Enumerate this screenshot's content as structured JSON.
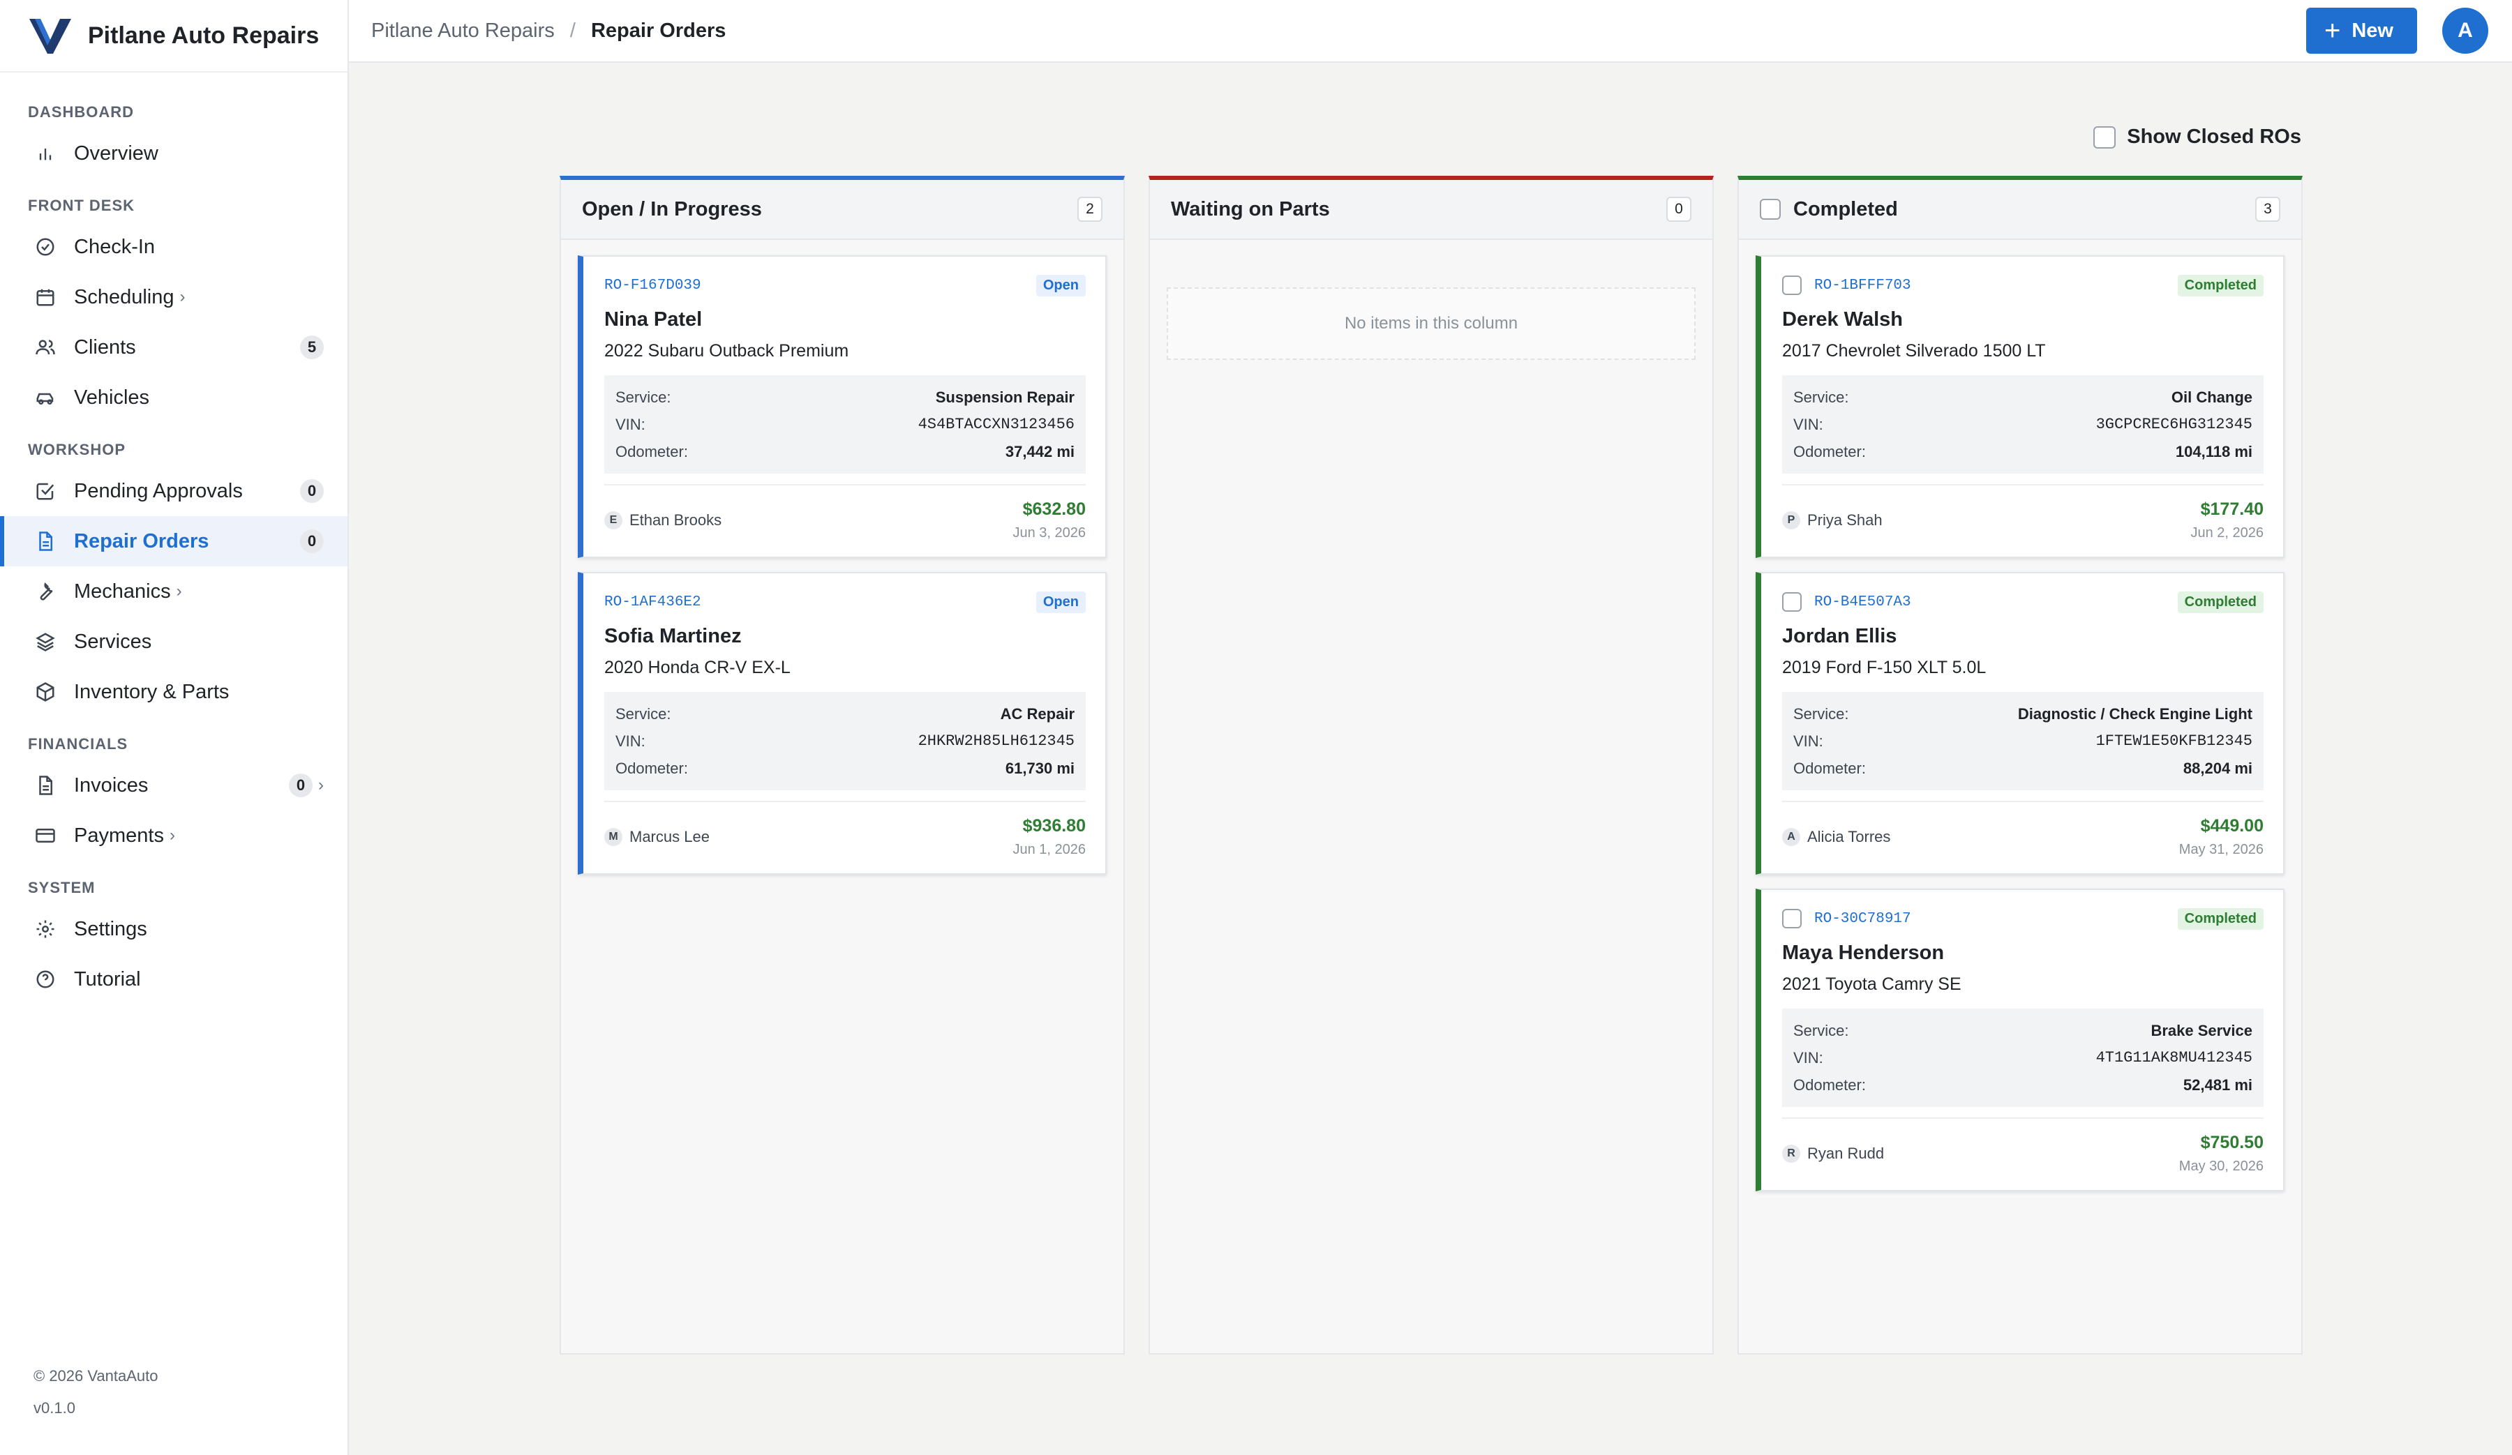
{
  "brand": {
    "name": "Pitlane Auto Repairs"
  },
  "sidebar": {
    "sections": [
      {
        "title": "DASHBOARD",
        "items": [
          {
            "label": "Overview",
            "icon": "bar-chart-icon"
          }
        ]
      },
      {
        "title": "FRONT DESK",
        "items": [
          {
            "label": "Check-In",
            "icon": "check-circle-icon"
          },
          {
            "label": "Scheduling",
            "icon": "calendar-icon",
            "chevron": true
          },
          {
            "label": "Clients",
            "icon": "users-icon",
            "badge": "5"
          },
          {
            "label": "Vehicles",
            "icon": "car-icon"
          }
        ]
      },
      {
        "title": "WORKSHOP",
        "items": [
          {
            "label": "Pending Approvals",
            "icon": "check-square-icon",
            "badge": "0"
          },
          {
            "label": "Repair Orders",
            "icon": "document-icon",
            "badge": "0",
            "active": true
          },
          {
            "label": "Mechanics",
            "icon": "wrench-icon",
            "chevron": true
          },
          {
            "label": "Services",
            "icon": "layers-icon"
          },
          {
            "label": "Inventory & Parts",
            "icon": "box-icon"
          }
        ]
      },
      {
        "title": "FINANCIALS",
        "items": [
          {
            "label": "Invoices",
            "icon": "document-icon",
            "badge": "0",
            "chevron": true
          },
          {
            "label": "Payments",
            "icon": "credit-card-icon",
            "chevron": true
          }
        ]
      },
      {
        "title": "SYSTEM",
        "items": [
          {
            "label": "Settings",
            "icon": "gear-icon"
          },
          {
            "label": "Tutorial",
            "icon": "help-circle-icon"
          }
        ]
      }
    ],
    "footer": {
      "copyright": "© 2026 VantaAuto",
      "version": "v0.1.0"
    }
  },
  "header": {
    "breadcrumb": {
      "root": "Pitlane Auto Repairs",
      "separator": "/",
      "current": "Repair Orders"
    },
    "new_button": "New",
    "avatar_initial": "A"
  },
  "board": {
    "show_closed_label": "Show Closed ROs",
    "columns": {
      "open": {
        "title": "Open / In Progress",
        "count": "2"
      },
      "waiting": {
        "title": "Waiting on Parts",
        "count": "0",
        "empty_text": "No items in this column"
      },
      "completed": {
        "title": "Completed",
        "count": "3"
      }
    },
    "detail_labels": {
      "service": "Service:",
      "vin": "VIN:",
      "odometer": "Odometer:"
    },
    "open_cards": [
      {
        "ro": "RO-F167D039",
        "status": "Open",
        "customer": "Nina Patel",
        "vehicle": "2022 Subaru Outback Premium",
        "service": "Suspension Repair",
        "vin": "4S4BTACCXN3123456",
        "odometer": "37,442 mi",
        "mechanic_initial": "E",
        "mechanic": "Ethan Brooks",
        "amount": "$632.80",
        "date": "Jun 3, 2026"
      },
      {
        "ro": "RO-1AF436E2",
        "status": "Open",
        "customer": "Sofia Martinez",
        "vehicle": "2020 Honda CR-V EX-L",
        "service": "AC Repair",
        "vin": "2HKRW2H85LH612345",
        "odometer": "61,730 mi",
        "mechanic_initial": "M",
        "mechanic": "Marcus Lee",
        "amount": "$936.80",
        "date": "Jun 1, 2026"
      }
    ],
    "completed_cards": [
      {
        "ro": "RO-1BFFF703",
        "status": "Completed",
        "customer": "Derek Walsh",
        "vehicle": "2017 Chevrolet Silverado 1500 LT",
        "service": "Oil Change",
        "vin": "3GCPCREC6HG312345",
        "odometer": "104,118 mi",
        "mechanic_initial": "P",
        "mechanic": "Priya Shah",
        "amount": "$177.40",
        "date": "Jun 2, 2026"
      },
      {
        "ro": "RO-B4E507A3",
        "status": "Completed",
        "customer": "Jordan Ellis",
        "vehicle": "2019 Ford F-150 XLT 5.0L",
        "service": "Diagnostic / Check Engine Light",
        "vin": "1FTEW1E50KFB12345",
        "odometer": "88,204 mi",
        "mechanic_initial": "A",
        "mechanic": "Alicia Torres",
        "amount": "$449.00",
        "date": "May 31, 2026"
      },
      {
        "ro": "RO-30C78917",
        "status": "Completed",
        "customer": "Maya Henderson",
        "vehicle": "2021 Toyota Camry SE",
        "service": "Brake Service",
        "vin": "4T1G11AK8MU412345",
        "odometer": "52,481 mi",
        "mechanic_initial": "R",
        "mechanic": "Ryan Rudd",
        "amount": "$750.50",
        "date": "May 30, 2026"
      }
    ]
  },
  "colors": {
    "accent": "#1f6fd1",
    "open": "#2f6fd0",
    "waiting": "#b3221f",
    "completed": "#2e7d32"
  }
}
